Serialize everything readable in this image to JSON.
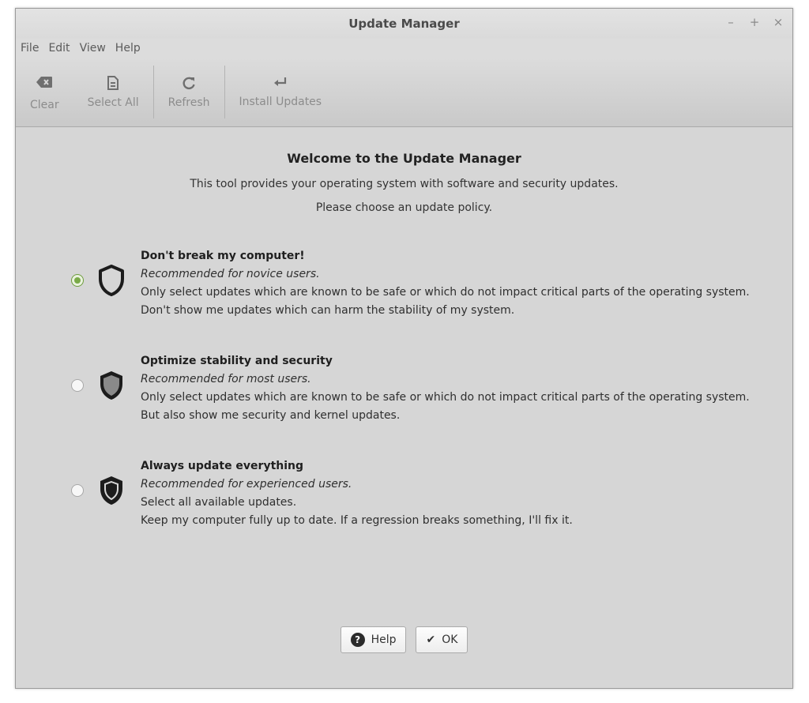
{
  "window": {
    "title": "Update Manager",
    "controls": {
      "minimize": "–",
      "maximize": "+",
      "close": "×"
    }
  },
  "menu": [
    "File",
    "Edit",
    "View",
    "Help"
  ],
  "toolbar": {
    "clear": "Clear",
    "select_all": "Select All",
    "refresh": "Refresh",
    "install_updates": "Install Updates"
  },
  "main": {
    "welcome": "Welcome to the Update Manager",
    "description": "This tool provides your operating system with software and security updates.",
    "prompt": "Please choose an update policy."
  },
  "policies": [
    {
      "title": "Don't break my computer!",
      "recommendation": "Recommended for novice users.",
      "line1": "Only select updates which are known to be safe or which do not impact critical parts of the operating system.",
      "line2": "Don't show me updates which can harm the stability of my system.",
      "selected": true
    },
    {
      "title": "Optimize stability and security",
      "recommendation": "Recommended for most users.",
      "line1": "Only select updates which are known to be safe or which do not impact critical parts of the operating system.",
      "line2": "But also show me security and kernel updates.",
      "selected": false
    },
    {
      "title": "Always update everything",
      "recommendation": "Recommended for experienced users.",
      "line1": "Select all available updates.",
      "line2": "Keep my computer fully up to date. If a regression breaks something, I'll fix it.",
      "selected": false
    }
  ],
  "buttons": {
    "help": "Help",
    "ok": "OK"
  },
  "icons": {
    "clear": "backspace-icon",
    "select_all": "document-icon",
    "refresh": "refresh-icon",
    "install": "return-arrow-icon",
    "help": "help-icon",
    "ok": "checkmark-icon"
  },
  "colors": {
    "radio_selected": "#7aaa48",
    "window_bg": "#d6d6d6"
  }
}
